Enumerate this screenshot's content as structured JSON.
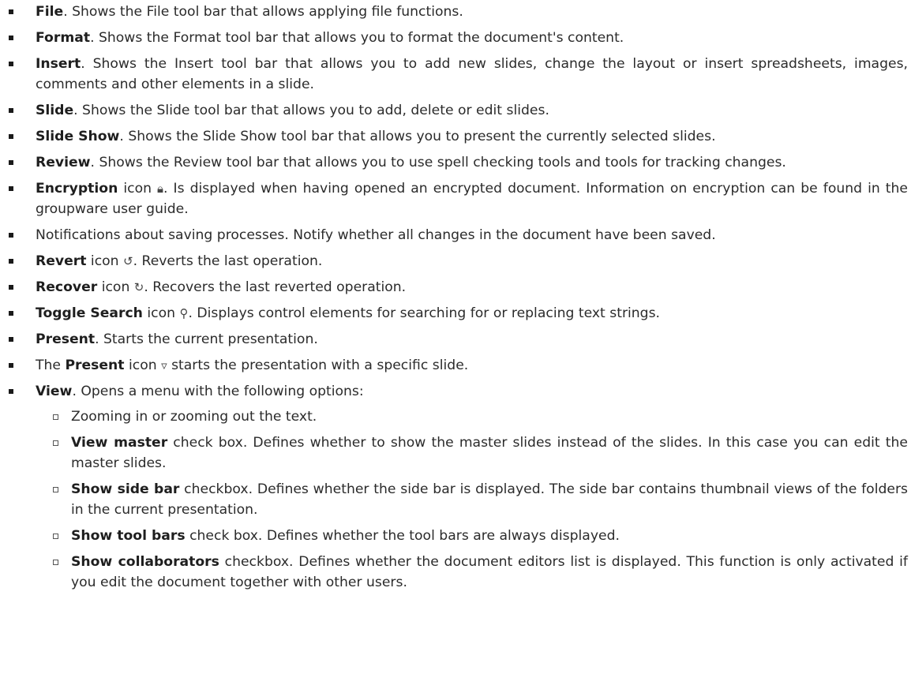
{
  "items": [
    {
      "term": "File",
      "text": ". Shows the File tool bar that allows applying file functions."
    },
    {
      "term": "Format",
      "text": ". Shows the Format tool bar that allows you to format the document's content."
    },
    {
      "term": "Insert",
      "text": ". Shows the Insert tool bar that allows you to add new slides, change the layout or insert spreadsheets, images, comments and other elements in a slide."
    },
    {
      "term": "Slide",
      "text": ". Shows the Slide tool bar that allows you to add, delete or edit slides."
    },
    {
      "term": "Slide Show",
      "text": ". Shows the Slide Show tool bar that allows you to present the currently selected slides."
    },
    {
      "term": "Review",
      "text": ". Shows the Review tool bar that allows you to use spell checking tools and tools for tracking changes."
    },
    {
      "term": "Encryption",
      "pre_icon": " icon ",
      "icon": "lock-icon",
      "icon_glyph": "🔒︎",
      "text": ". Is displayed when having opened an encrypted document. Information on encryption can be found in the groupware user guide."
    },
    {
      "plain": "Notifications about saving processes. Notify whether all changes in the document have been saved."
    },
    {
      "term": "Revert",
      "pre_icon": " icon ",
      "icon": "undo-icon",
      "icon_glyph": "↺",
      "text": ". Reverts the last operation."
    },
    {
      "term": "Recover",
      "pre_icon": " icon ",
      "icon": "redo-icon",
      "icon_glyph": "↻",
      "text": ". Recovers the last reverted operation."
    },
    {
      "term": "Toggle Search",
      "pre_icon": " icon ",
      "icon": "search-icon",
      "icon_glyph": "⚲",
      "text": ". Displays control elements for searching for or replacing text strings."
    },
    {
      "term": "Present",
      "text": ". Starts the current presentation."
    },
    {
      "lead": "The ",
      "term": "Present",
      "pre_icon": " icon ",
      "icon": "chevron-down-icon",
      "icon_glyph": "▿",
      "text": " starts the presentation with a specific slide."
    },
    {
      "term": "View",
      "text": ". Opens a menu with the following options:"
    }
  ],
  "view_options": [
    {
      "plain": "Zooming in or zooming out the text."
    },
    {
      "term": "View master",
      "text": " check box. Defines whether to show the master slides instead of the slides. In this case you can edit the master slides."
    },
    {
      "term": "Show side bar",
      "text": " checkbox. Defines whether the side bar is displayed. The side bar contains thumbnail views of the folders in the current presentation."
    },
    {
      "term": "Show tool bars",
      "text": " check box. Defines whether the tool bars are always displayed."
    },
    {
      "term": "Show collaborators",
      "text": " checkbox. Defines whether the document editors list is displayed. This function is only activated if you edit the document together with other users."
    }
  ]
}
